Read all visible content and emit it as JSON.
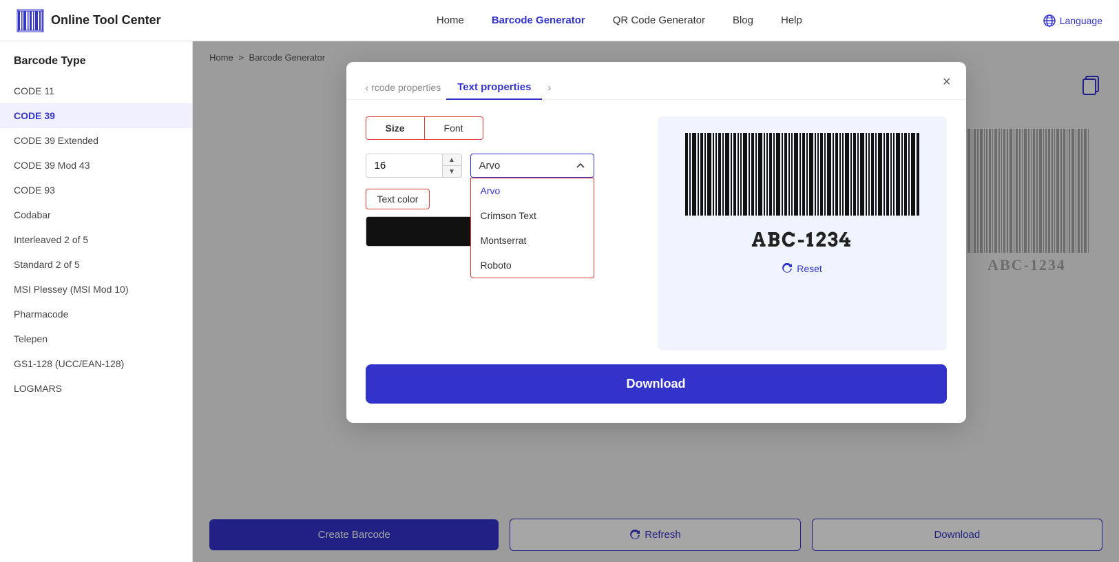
{
  "header": {
    "logo_text": "Online Tool Center",
    "nav": [
      {
        "label": "Home",
        "active": false
      },
      {
        "label": "Barcode Generator",
        "active": true
      },
      {
        "label": "QR Code Generator",
        "active": false
      },
      {
        "label": "Blog",
        "active": false
      },
      {
        "label": "Help",
        "active": false
      }
    ],
    "language": "Language"
  },
  "sidebar": {
    "title": "Barcode Type",
    "items": [
      {
        "label": "CODE 11",
        "active": false
      },
      {
        "label": "CODE 39",
        "active": true
      },
      {
        "label": "CODE 39 Extended",
        "active": false
      },
      {
        "label": "CODE 39 Mod 43",
        "active": false
      },
      {
        "label": "CODE 93",
        "active": false
      },
      {
        "label": "Codabar",
        "active": false
      },
      {
        "label": "Interleaved 2 of 5",
        "active": false
      },
      {
        "label": "Standard 2 of 5",
        "active": false
      },
      {
        "label": "MSI Plessey (MSI Mod 10)",
        "active": false
      },
      {
        "label": "Pharmacode",
        "active": false
      },
      {
        "label": "Telepen",
        "active": false
      },
      {
        "label": "GS1-128 (UCC/EAN-128)",
        "active": false
      },
      {
        "label": "LOGMARS",
        "active": false
      }
    ]
  },
  "breadcrumb": {
    "home": "Home",
    "sep": ">",
    "current": "Barcode Generator"
  },
  "bottom_bar": {
    "create": "Create Barcode",
    "refresh": "Refresh",
    "download": "Download"
  },
  "modal": {
    "tab_prev": "‹ rcode properties",
    "tab_active": "Text properties",
    "tab_next": "›",
    "close": "×",
    "prop_tabs": {
      "size": "Size",
      "font": "Font"
    },
    "size_value": "16",
    "font_selected": "Arvo",
    "font_options": [
      "Arvo",
      "Crimson Text",
      "Montserrat",
      "Roboto"
    ],
    "text_color_label": "Text color",
    "color_value": "#111111",
    "barcode_text": "ABC-1234",
    "reset_label": "Reset",
    "download_label": "Download"
  }
}
